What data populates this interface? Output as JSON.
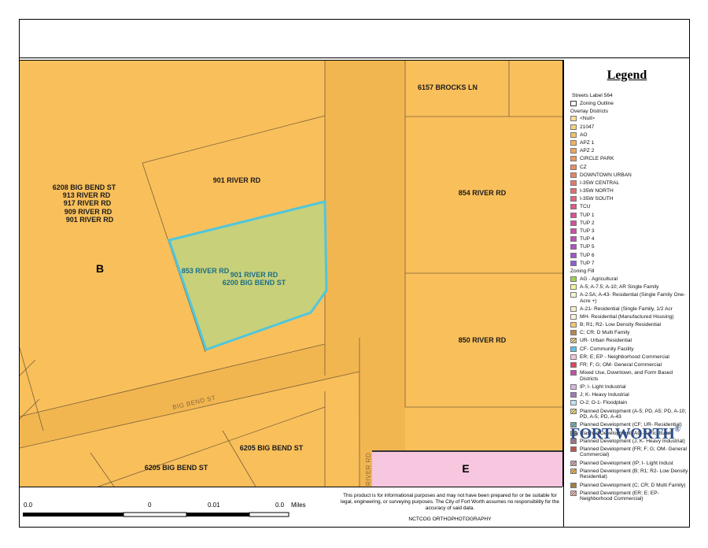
{
  "title": "",
  "legend": {
    "title": "Legend",
    "streets_label": "Streets Label 564",
    "zoning_outline": "Zoning Outline",
    "overlay_header": "Overlay Districts",
    "overlay_items": [
      {
        "label": "<Null>",
        "color": "#f6df94"
      },
      {
        "label": "21047",
        "color": "#f5d37a"
      },
      {
        "label": "AO",
        "color": "#f4c463"
      },
      {
        "label": "APZ 1",
        "color": "#f2b35a"
      },
      {
        "label": "APZ 2",
        "color": "#f0a55a"
      },
      {
        "label": "CIRCLE PARK",
        "color": "#ee9a5c"
      },
      {
        "label": "CZ",
        "color": "#ec8e60"
      },
      {
        "label": "DOWNTOWN URBAN",
        "color": "#ea8466"
      },
      {
        "label": "I-35W CENTRAL",
        "color": "#e8786c"
      },
      {
        "label": "I-35W NORTH",
        "color": "#e66c74"
      },
      {
        "label": "I-35W SOUTH",
        "color": "#e4627c"
      },
      {
        "label": "TCU",
        "color": "#e25886"
      },
      {
        "label": "TUP 1",
        "color": "#df5290"
      },
      {
        "label": "TUP 2",
        "color": "#d84f9c"
      },
      {
        "label": "TUP 3",
        "color": "#cf4ea8"
      },
      {
        "label": "TUP 4",
        "color": "#c24fb5"
      },
      {
        "label": "TUP 5",
        "color": "#b252c2"
      },
      {
        "label": "TUP 6",
        "color": "#9f58cc"
      },
      {
        "label": "TUP 7",
        "color": "#8a5fd3"
      }
    ],
    "zoning_header": "Zoning Fill",
    "zoning_items": [
      {
        "label": "AG - Agricultural",
        "color": "#9ed34f",
        "hatch": false
      },
      {
        "label": "A-5; A-7.5; A-10; AR Single Family",
        "color": "#f3f59b",
        "hatch": false
      },
      {
        "label": "A-2.5A; A-43- Residential (Single Family One-Acre +)",
        "color": "#f1f7d3",
        "hatch": false
      },
      {
        "label": "A-21- Residential (Single Family, 1/2 Acr",
        "color": "#f8f1c6",
        "hatch": false
      },
      {
        "label": "MH- Residential (Manufactured Housing)",
        "color": "#fbf3de",
        "hatch": false
      },
      {
        "label": "B; R1; R2- Low Density Residential",
        "color": "#f6c66a",
        "hatch": false
      },
      {
        "label": "C; CR; D Multi Family",
        "color": "#b08a4b",
        "hatch": false
      },
      {
        "label": "UR- Urban Residential",
        "color": "#f3e6a7",
        "hatch": true
      },
      {
        "label": "CF- Community Facility",
        "color": "#5ec3e6",
        "hatch": false
      },
      {
        "label": "ER; E; EP - Neighborhood Commercial",
        "color": "#f6c4dc",
        "hatch": false
      },
      {
        "label": "FR; F; G; OM- General Commercial",
        "color": "#e0465b",
        "hatch": false
      },
      {
        "label": "Mixed Use, Downtown, and Form Based Districts",
        "color": "#c24fa0",
        "hatch": false
      },
      {
        "label": "IP; I- Light Industrial",
        "color": "#d7b6e2",
        "hatch": false
      },
      {
        "label": "J; K- Heavy Industrial",
        "color": "#9b7bb8",
        "hatch": false
      },
      {
        "label": "O-2; O-1- Floodplain",
        "color": "#bfe3f1",
        "hatch": false
      },
      {
        "label": "Planned Development (A-5; PD, A5; PD, A-10; PD, A-5; PD, A-43",
        "color": "#f3f59b",
        "hatch": true
      },
      {
        "label": "Planned Development (CF; UR- Residential)",
        "color": "#5ec3e6",
        "hatch": true
      },
      {
        "label": "Planned Development (AG- Agricultural)",
        "color": "#9ed34f",
        "hatch": true
      },
      {
        "label": "Planned Development (J; K- Heavy Industrial)",
        "color": "#9b7bb8",
        "hatch": true
      },
      {
        "label": "Planned Development (FR; F; G; OM- General Commercial)",
        "color": "#e0465b",
        "hatch": true
      },
      {
        "label": "Planned Development (IP; I- Light Indust",
        "color": "#d7b6e2",
        "hatch": true
      },
      {
        "label": "Planned Development (B; R1; R2- Low Density Residential)",
        "color": "#f6c66a",
        "hatch": true
      },
      {
        "label": "Planned Development (C; CR; D Multi Family)",
        "color": "#b08a4b",
        "hatch": true
      },
      {
        "label": "Planned Development (ER; E; EP- Neighborhood Commercial)",
        "color": "#f6c4dc",
        "hatch": true
      }
    ],
    "logo": "FORT WORTH",
    "logo_mark": "®"
  },
  "map": {
    "parcels": [
      {
        "label": "6157 BROCKS LN"
      },
      {
        "label": "901 RIVER RD"
      },
      {
        "label": "854 RIVER RD"
      },
      {
        "label": "850 RIVER RD"
      },
      {
        "label": "6205 BIG BEND ST"
      },
      {
        "label": "6205 BIG BEND ST"
      }
    ],
    "multi_label": [
      "6208 BIG BEND ST",
      "913 RIVER RD",
      "917 RIVER RD",
      "909 RIVER RD",
      "901 RIVER RD"
    ],
    "selected": {
      "lines": [
        "853 RIVER RD",
        "901 RIVER RD",
        "6200 BIG BEND ST"
      ]
    },
    "zones": [
      "B",
      "E"
    ],
    "streets": [
      "BIG BEND ST",
      "RIVER RD"
    ],
    "colors": {
      "residential": "#f9bf5b",
      "road": "#f2b651",
      "selected_fill": "#c8d07a",
      "selected_outline": "#4fc6dc",
      "commercial": "#f7c6df"
    }
  },
  "scale": {
    "ticks": [
      "0.0",
      "0",
      "0.01",
      "0.0"
    ],
    "unit": "Miles"
  },
  "disclaimer": "This product is for informational purposes and may not have been prepared for or be suitable for legal, engineering, or surveying purposes. The City of Fort Worth assumes no responsibility for the accuracy of said data.",
  "credit": "NCTCOG ORTHOPHOTOGRAPHY"
}
